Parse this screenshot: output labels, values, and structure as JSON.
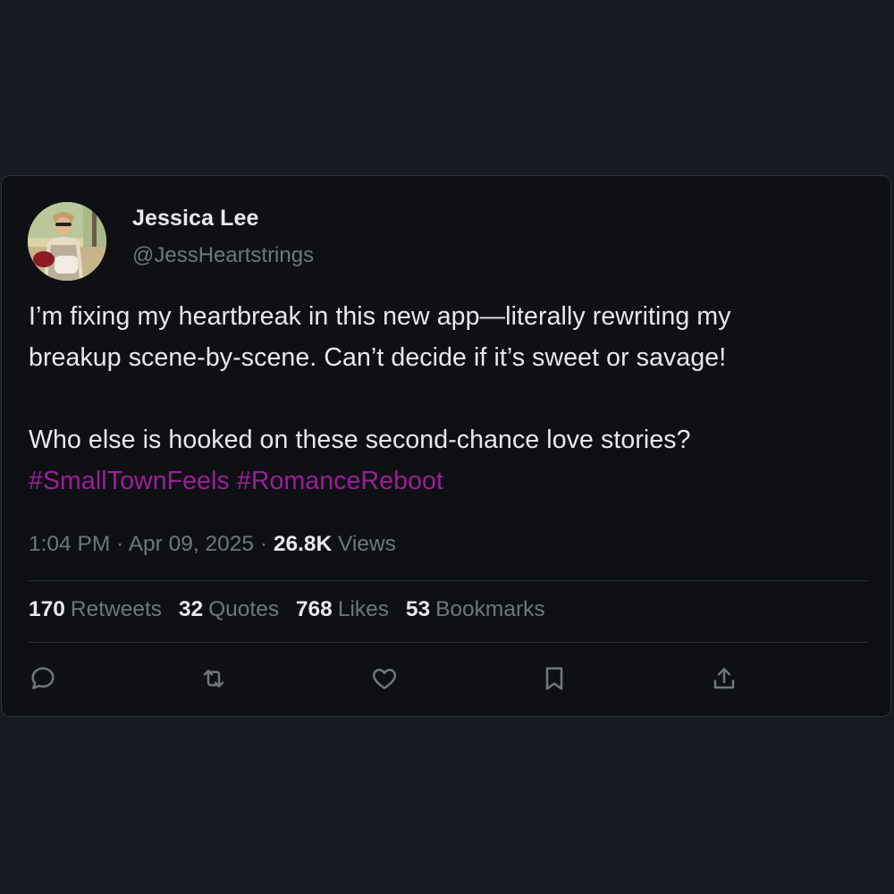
{
  "author": {
    "name": "Jessica Lee",
    "handle": "@JessHeartstrings",
    "avatar_icon": "profile-photo"
  },
  "tweet": {
    "line1": "I’m fixing my heartbreak in this new app—literally rewriting my",
    "line2": "breakup scene-by-scene. Can’t decide if it’s sweet or savage!",
    "line3": "Who else is hooked on these second-chance love stories?",
    "hashtag1": "#SmallTownFeels",
    "hashtag2": "#RomanceReboot"
  },
  "meta": {
    "time": "1:04 PM",
    "separator1": "·",
    "date": "Apr 09, 2025",
    "separator2": "·",
    "views_count": "26.8K",
    "views_label": "Views"
  },
  "stats": {
    "retweets_count": "170",
    "retweets_label": "Retweets",
    "quotes_count": "32",
    "quotes_label": "Quotes",
    "likes_count": "768",
    "likes_label": "Likes",
    "bookmarks_count": "53",
    "bookmarks_label": "Bookmarks"
  },
  "actions": [
    "reply-icon",
    "retweet-icon",
    "like-icon",
    "bookmark-icon",
    "share-icon"
  ],
  "colors": {
    "background": "#161b22",
    "card": "#0e1014",
    "hashtag": "#9b1f99",
    "muted": "#71767b",
    "text": "#e7e9ea"
  }
}
